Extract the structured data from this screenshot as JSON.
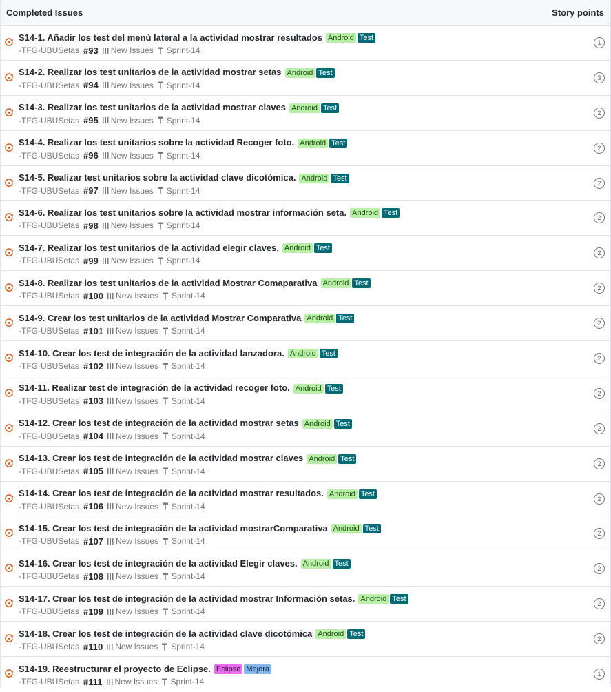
{
  "header": {
    "title": "Completed Issues",
    "points_label": "Story points"
  },
  "colors": {
    "android_bg": "#b9f0a8",
    "android_text": "#1c4f0f",
    "test_bg": "#006b75",
    "test_text": "#ffffff",
    "eclipse_bg": "#ea6df0",
    "eclipse_text": "#3a0a3d",
    "mejora_bg": "#84b6eb",
    "mejora_text": "#0a2b4f",
    "state_icon": "#d45a1a"
  },
  "issues": [
    {
      "title": "S14-1. Añadir los test del menú lateral a la actividad mostrar resultados",
      "labels": [
        {
          "text": "Android",
          "kind": "android"
        },
        {
          "text": "Test",
          "kind": "test"
        }
      ],
      "repo": "-TFG-UBUSetas",
      "number": "#93",
      "pipeline": "New Issues",
      "milestone": "Sprint-14",
      "points": "1"
    },
    {
      "title": "S14-2. Realizar los test unitarios de la actividad mostrar setas",
      "labels": [
        {
          "text": "Android",
          "kind": "android"
        },
        {
          "text": "Test",
          "kind": "test"
        }
      ],
      "repo": "-TFG-UBUSetas",
      "number": "#94",
      "pipeline": "New Issues",
      "milestone": "Sprint-14",
      "points": "3"
    },
    {
      "title": "S14-3. Realizar los test unitarios de la actividad mostrar claves",
      "labels": [
        {
          "text": "Android",
          "kind": "android"
        },
        {
          "text": "Test",
          "kind": "test"
        }
      ],
      "repo": "-TFG-UBUSetas",
      "number": "#95",
      "pipeline": "New Issues",
      "milestone": "Sprint-14",
      "points": "2"
    },
    {
      "title": "S14-4. Realizar los test unitarios sobre la actividad Recoger foto.",
      "labels": [
        {
          "text": "Android",
          "kind": "android"
        },
        {
          "text": "Test",
          "kind": "test"
        }
      ],
      "repo": "-TFG-UBUSetas",
      "number": "#96",
      "pipeline": "New Issues",
      "milestone": "Sprint-14",
      "points": "2"
    },
    {
      "title": "S14-5. Realizar test unitarios sobre la actividad clave dicotómica.",
      "labels": [
        {
          "text": "Android",
          "kind": "android"
        },
        {
          "text": "Test",
          "kind": "test"
        }
      ],
      "repo": "-TFG-UBUSetas",
      "number": "#97",
      "pipeline": "New Issues",
      "milestone": "Sprint-14",
      "points": "2"
    },
    {
      "title": "S14-6. Realizar los test unitarios sobre la actividad mostrar información seta.",
      "labels": [
        {
          "text": "Android",
          "kind": "android"
        },
        {
          "text": "Test",
          "kind": "test"
        }
      ],
      "repo": "-TFG-UBUSetas",
      "number": "#98",
      "pipeline": "New Issues",
      "milestone": "Sprint-14",
      "points": "2"
    },
    {
      "title": "S14-7. Realizar los test unitarios de la actividad elegir claves.",
      "labels": [
        {
          "text": "Android",
          "kind": "android"
        },
        {
          "text": "Test",
          "kind": "test"
        }
      ],
      "repo": "-TFG-UBUSetas",
      "number": "#99",
      "pipeline": "New Issues",
      "milestone": "Sprint-14",
      "points": "2"
    },
    {
      "title": "S14-8. Realizar los test unitarios de la actividad Mostrar Comaparativa",
      "labels": [
        {
          "text": "Android",
          "kind": "android"
        },
        {
          "text": "Test",
          "kind": "test"
        }
      ],
      "repo": "-TFG-UBUSetas",
      "number": "#100",
      "pipeline": "New Issues",
      "milestone": "Sprint-14",
      "points": "2"
    },
    {
      "title": "S14-9. Crear los test unitarios de la actividad Mostrar Comparativa",
      "labels": [
        {
          "text": "Android",
          "kind": "android"
        },
        {
          "text": "Test",
          "kind": "test"
        }
      ],
      "repo": "-TFG-UBUSetas",
      "number": "#101",
      "pipeline": "New Issues",
      "milestone": "Sprint-14",
      "points": "2"
    },
    {
      "title": "S14-10. Crear los test de integración de la actividad lanzadora.",
      "labels": [
        {
          "text": "Android",
          "kind": "android"
        },
        {
          "text": "Test",
          "kind": "test"
        }
      ],
      "repo": "-TFG-UBUSetas",
      "number": "#102",
      "pipeline": "New Issues",
      "milestone": "Sprint-14",
      "points": "2"
    },
    {
      "title": "S14-11. Realizar test de integración de la actividad recoger foto.",
      "labels": [
        {
          "text": "Android",
          "kind": "android"
        },
        {
          "text": "Test",
          "kind": "test"
        }
      ],
      "repo": "-TFG-UBUSetas",
      "number": "#103",
      "pipeline": "New Issues",
      "milestone": "Sprint-14",
      "points": "2"
    },
    {
      "title": "S14-12. Crear los test de integración de la actividad mostrar setas",
      "labels": [
        {
          "text": "Android",
          "kind": "android"
        },
        {
          "text": "Test",
          "kind": "test"
        }
      ],
      "repo": "-TFG-UBUSetas",
      "number": "#104",
      "pipeline": "New Issues",
      "milestone": "Sprint-14",
      "points": "2"
    },
    {
      "title": "S14-13. Crear los test de integración de la actividad mostrar claves",
      "labels": [
        {
          "text": "Android",
          "kind": "android"
        },
        {
          "text": "Test",
          "kind": "test"
        }
      ],
      "repo": "-TFG-UBUSetas",
      "number": "#105",
      "pipeline": "New Issues",
      "milestone": "Sprint-14",
      "points": "2"
    },
    {
      "title": "S14-14. Crear los test de integración de la actividad mostrar resultados.",
      "labels": [
        {
          "text": "Android",
          "kind": "android"
        },
        {
          "text": "Test",
          "kind": "test"
        }
      ],
      "repo": "-TFG-UBUSetas",
      "number": "#106",
      "pipeline": "New Issues",
      "milestone": "Sprint-14",
      "points": "2"
    },
    {
      "title": "S14-15. Crear los test de integración de la actividad mostrarComparativa",
      "labels": [
        {
          "text": "Android",
          "kind": "android"
        },
        {
          "text": "Test",
          "kind": "test"
        }
      ],
      "repo": "-TFG-UBUSetas",
      "number": "#107",
      "pipeline": "New Issues",
      "milestone": "Sprint-14",
      "points": "2"
    },
    {
      "title": "S14-16. Crear los test de integración de la actividad Elegir claves.",
      "labels": [
        {
          "text": "Android",
          "kind": "android"
        },
        {
          "text": "Test",
          "kind": "test"
        }
      ],
      "repo": "-TFG-UBUSetas",
      "number": "#108",
      "pipeline": "New Issues",
      "milestone": "Sprint-14",
      "points": "2"
    },
    {
      "title": "S14-17. Crear los test de integración de la actividad mostrar Información setas.",
      "labels": [
        {
          "text": "Android",
          "kind": "android"
        },
        {
          "text": "Test",
          "kind": "test"
        }
      ],
      "repo": "-TFG-UBUSetas",
      "number": "#109",
      "pipeline": "New Issues",
      "milestone": "Sprint-14",
      "points": "2"
    },
    {
      "title": "S14-18. Crear los test de integración de la actividad clave dicotómica",
      "labels": [
        {
          "text": "Android",
          "kind": "android"
        },
        {
          "text": "Test",
          "kind": "test"
        }
      ],
      "repo": "-TFG-UBUSetas",
      "number": "#110",
      "pipeline": "New Issues",
      "milestone": "Sprint-14",
      "points": "2"
    },
    {
      "title": "S14-19. Reestructurar el proyecto de Eclipse.",
      "labels": [
        {
          "text": "Eclipse",
          "kind": "eclipse"
        },
        {
          "text": "Mejora",
          "kind": "mejora"
        }
      ],
      "repo": "-TFG-UBUSetas",
      "number": "#111",
      "pipeline": "New Issues",
      "milestone": "Sprint-14",
      "points": "1"
    }
  ]
}
